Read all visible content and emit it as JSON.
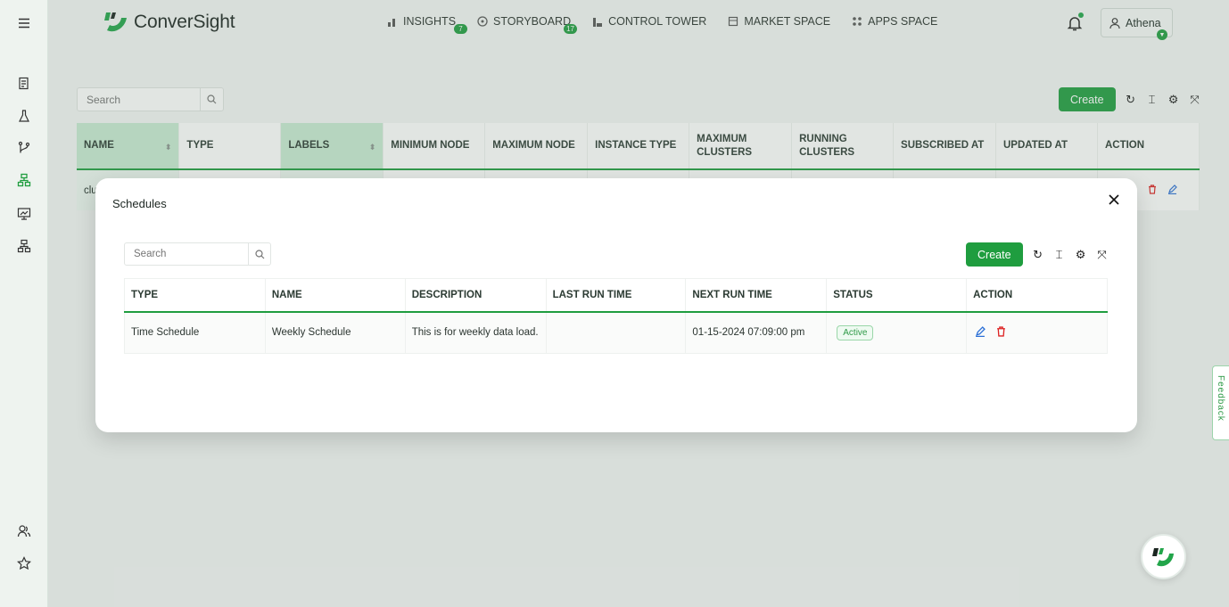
{
  "brand": {
    "name": "ConverSight",
    "accent": "#1f9d3f"
  },
  "nav": {
    "items": [
      {
        "label": "INSIGHTS",
        "badge": "7",
        "icon": "bar-chart-icon"
      },
      {
        "label": "STORYBOARD",
        "badge": "17",
        "icon": "gauge-icon"
      },
      {
        "label": "CONTROL TOWER",
        "badge": "",
        "icon": "tower-icon"
      },
      {
        "label": "MARKET SPACE",
        "badge": "",
        "icon": "store-icon"
      },
      {
        "label": "APPS SPACE",
        "badge": "",
        "icon": "grid-icon"
      }
    ]
  },
  "user": {
    "name": "Athena"
  },
  "sidebar": {
    "icons": [
      "menu-icon",
      "report-icon",
      "flask-icon",
      "branch-icon",
      "cluster-icon",
      "presentation-icon",
      "hierarchy-icon",
      "users-icon",
      "star-icon"
    ]
  },
  "background": {
    "search_placeholder": "Search",
    "create_label": "Create",
    "columns": [
      "NAME",
      "TYPE",
      "LABELS",
      "MINIMUM NODE",
      "MAXIMUM NODE",
      "INSTANCE TYPE",
      "MAXIMUM CLUSTERS",
      "RUNNING CLUSTERS",
      "SUBSCRIBED AT",
      "UPDATED AT",
      "ACTION"
    ],
    "row_name": "clu"
  },
  "modal": {
    "title": "Schedules",
    "search_placeholder": "Search",
    "create_label": "Create",
    "columns": [
      "TYPE",
      "NAME",
      "DESCRIPTION",
      "LAST RUN TIME",
      "NEXT RUN TIME",
      "STATUS",
      "ACTION"
    ],
    "rows": [
      {
        "type": "Time Schedule",
        "name": "Weekly Schedule",
        "description": "This is for weekly data load.",
        "last_run": "",
        "next_run": "01-15-2024 07:09:00 pm",
        "status": "Active"
      }
    ]
  },
  "feedback": {
    "label": "Feedback"
  }
}
